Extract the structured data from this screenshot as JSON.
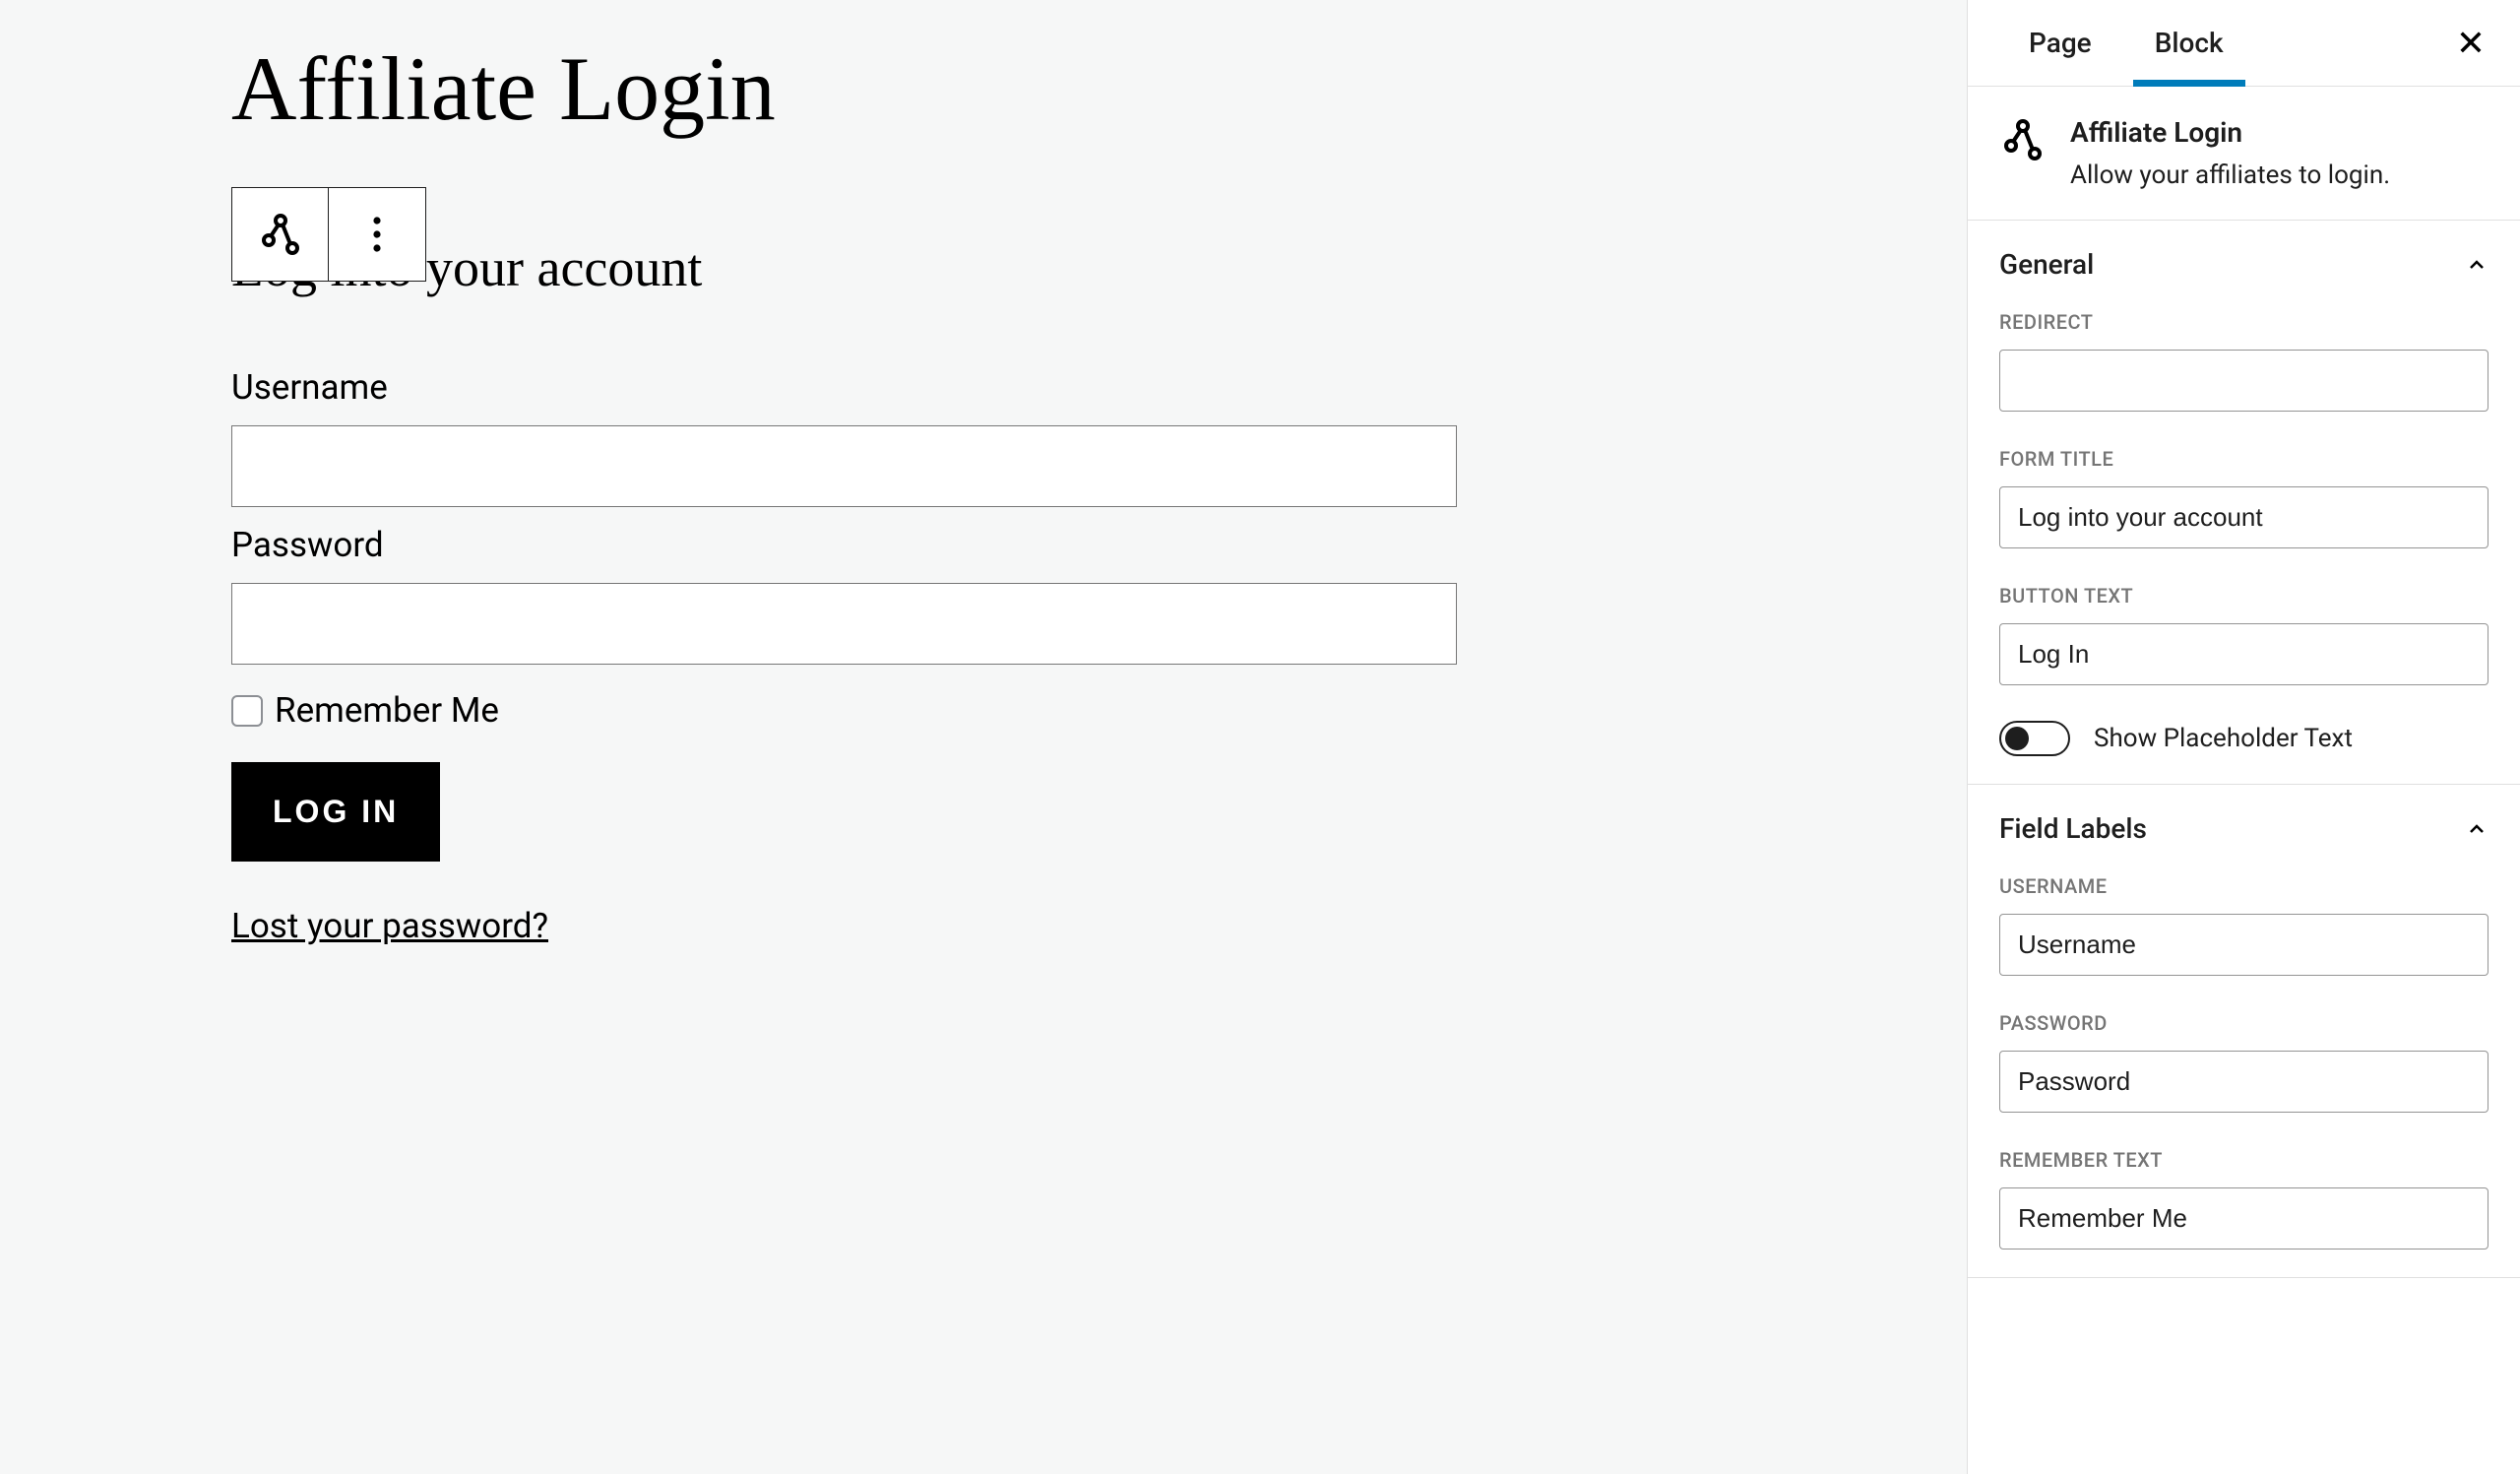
{
  "page": {
    "title": "Affiliate Login",
    "form_title": "Log into your account",
    "username_label": "Username",
    "password_label": "Password",
    "remember_label": "Remember Me",
    "login_button": "LOG IN",
    "lost_password": "Lost your password?"
  },
  "sidebar": {
    "tabs": {
      "page": "Page",
      "block": "Block"
    },
    "block_info": {
      "title": "Affiliate Login",
      "description": "Allow your affiliates to login."
    },
    "panels": {
      "general": {
        "title": "General",
        "redirect_label": "REDIRECT",
        "redirect_value": "",
        "form_title_label": "FORM TITLE",
        "form_title_value": "Log into your account",
        "button_text_label": "BUTTON TEXT",
        "button_text_value": "Log In",
        "show_placeholder_label": "Show Placeholder Text"
      },
      "field_labels": {
        "title": "Field Labels",
        "username_label": "USERNAME",
        "username_value": "Username",
        "password_label": "PASSWORD",
        "password_value": "Password",
        "remember_label": "REMEMBER TEXT",
        "remember_value": "Remember Me"
      }
    }
  }
}
